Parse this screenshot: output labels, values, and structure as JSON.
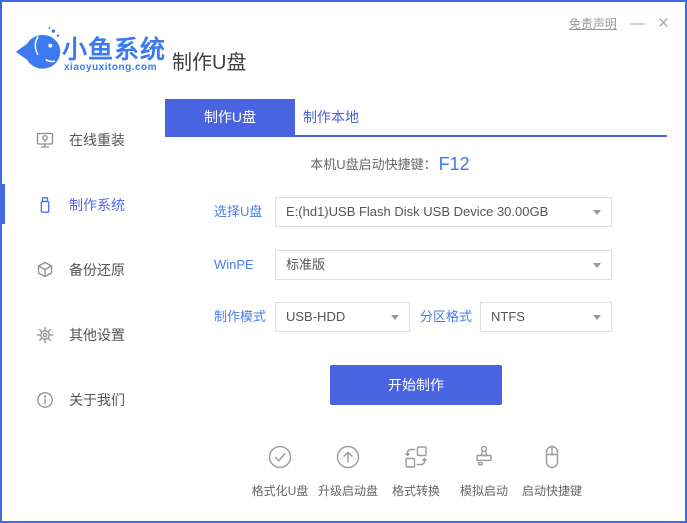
{
  "window": {
    "disclaimer": "免责声明",
    "minimize": "—",
    "close": "×"
  },
  "logo": {
    "name": "小鱼系统",
    "domain": "xiaoyuxitong.com"
  },
  "page_title": "制作U盘",
  "sidebar": {
    "items": [
      {
        "label": "在线重装",
        "icon": "monitor-icon",
        "active": false
      },
      {
        "label": "制作系统",
        "icon": "usb-drive-icon",
        "active": true
      },
      {
        "label": "备份还原",
        "icon": "backup-box-icon",
        "active": false
      },
      {
        "label": "其他设置",
        "icon": "gear-icon",
        "active": false
      },
      {
        "label": "关于我们",
        "icon": "info-icon",
        "active": false
      }
    ]
  },
  "tabs": [
    {
      "label": "制作U盘",
      "active": true
    },
    {
      "label": "制作本地",
      "active": false
    }
  ],
  "form": {
    "hotkey_label": "本机U盘启动快捷键：",
    "hotkey_value": "F12",
    "usb_label": "选择U盘",
    "usb_value": "E:(hd1)USB Flash Disk USB Device 30.00GB",
    "winpe_label": "WinPE",
    "winpe_value": "标准版",
    "mode_label": "制作模式",
    "mode_value": "USB-HDD",
    "partition_label": "分区格式",
    "partition_value": "NTFS",
    "start_button": "开始制作"
  },
  "footer_tools": [
    {
      "label": "格式化U盘",
      "icon": "format-check-icon"
    },
    {
      "label": "升级启动盘",
      "icon": "upgrade-arrow-icon"
    },
    {
      "label": "格式转换",
      "icon": "convert-icon"
    },
    {
      "label": "模拟启动",
      "icon": "simulate-stamp-icon"
    },
    {
      "label": "启动快捷键",
      "icon": "hotkey-mouse-icon"
    }
  ],
  "colors": {
    "primary": "#4864e0",
    "logo_blue": "#3b7af0",
    "label_blue": "#4a7ce8",
    "window_border": "#3e6be0"
  }
}
